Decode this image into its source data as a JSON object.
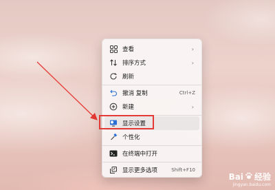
{
  "menu": {
    "items": [
      {
        "label": "查看",
        "icon": "grid-icon",
        "chevron": "›"
      },
      {
        "label": "排序方式",
        "icon": "sort-icon",
        "chevron": "›"
      },
      {
        "label": "刷新",
        "icon": "refresh-icon"
      },
      {
        "label": "撤消 复制",
        "icon": "undo-icon",
        "shortcut": "Ctrl+Z"
      },
      {
        "label": "新建",
        "icon": "new-icon",
        "chevron": "›"
      },
      {
        "label": "显示设置",
        "icon": "display-settings-icon"
      },
      {
        "label": "个性化",
        "icon": "personalize-icon"
      },
      {
        "label": "在终端中打开",
        "icon": "terminal-icon"
      },
      {
        "label": "显示更多选项",
        "icon": "more-options-icon",
        "shortcut": "Shift+F10"
      }
    ]
  },
  "annotation": {
    "color": "#e53935"
  },
  "watermark": {
    "brand_left": "Bai",
    "brand_right": "经验",
    "url": "jingyan.baidu.com"
  }
}
